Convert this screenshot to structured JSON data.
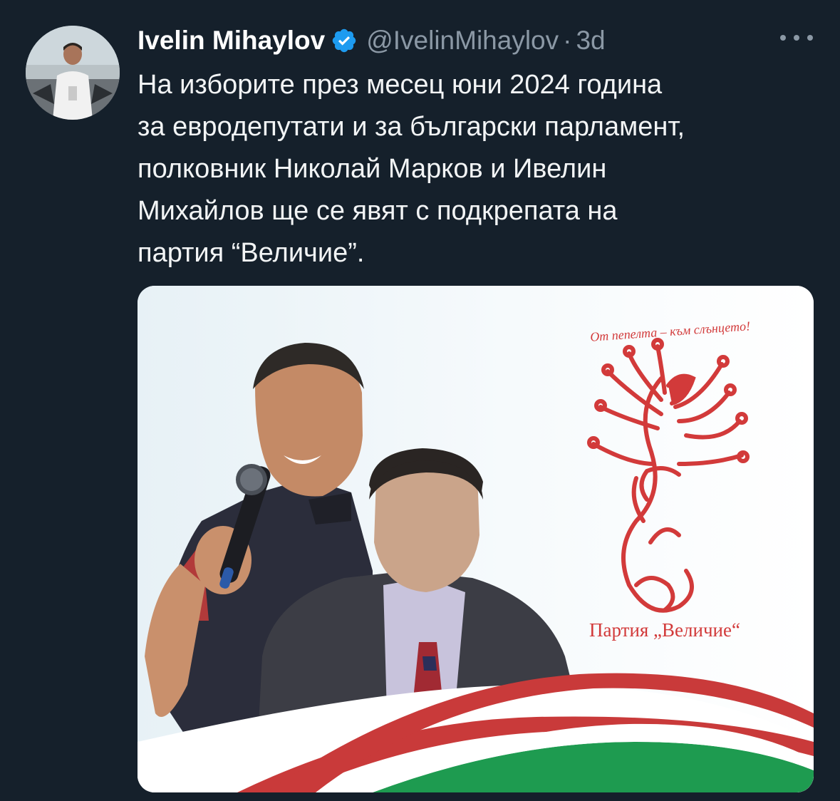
{
  "tweet": {
    "author_name": "Ivelin Mihaylov",
    "handle": "@IvelinMihaylov",
    "separator": "·",
    "time": "3d",
    "text_lines": [
      "На изборите през месец юни 2024 година",
      "за евродепутати и за български парламент,",
      "полковник Николай Марков и Ивелин",
      "Михайлов ще се явят с подкрепата на",
      "партия “Величие”."
    ],
    "icons": {
      "verified": "verified-badge-icon",
      "more": "more-options-icon"
    }
  },
  "media": {
    "logo_slogan": "От пепелта – към слънцето!",
    "logo_party": "Партия „Величие“"
  },
  "colors": {
    "background": "#15202b",
    "secondary_text": "#8b98a5",
    "verified": "#1d9bf0",
    "logo_red": "#d23a3a",
    "flag_green": "#1e9b50"
  }
}
